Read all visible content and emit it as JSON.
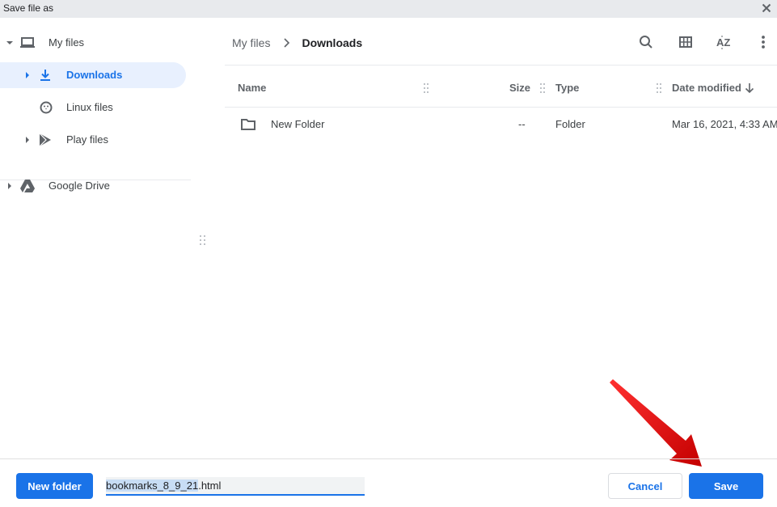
{
  "window": {
    "title": "Save file as",
    "close_icon": "close-icon"
  },
  "sidebar": {
    "items": [
      {
        "label": "My files",
        "icon": "laptop-icon",
        "expanded": true
      },
      {
        "label": "Downloads",
        "icon": "download-icon",
        "active": true
      },
      {
        "label": "Linux files",
        "icon": "linux-penguin-icon"
      },
      {
        "label": "Play files",
        "icon": "play-store-icon"
      },
      {
        "label": "Google Drive",
        "icon": "google-drive-icon"
      }
    ]
  },
  "breadcrumb": {
    "items": [
      "My files",
      "Downloads"
    ]
  },
  "toolbar": {
    "search": "search-icon",
    "grid_view": "grid-view-icon",
    "sort": "sort-az-icon",
    "more": "more-vert-icon"
  },
  "table": {
    "columns": [
      "Name",
      "Size",
      "Type",
      "Date modified"
    ],
    "sort_column": "Date modified",
    "sort_direction": "descending",
    "rows": [
      {
        "name": "New Folder",
        "size": "--",
        "type": "Folder",
        "date_modified": "Mar 16, 2021, 4:33 AM",
        "icon": "folder-icon"
      }
    ]
  },
  "footer": {
    "new_folder_label": "New folder",
    "filename_selected": "bookmarks_8_9_21",
    "filename_extension": ".html",
    "cancel_label": "Cancel",
    "save_label": "Save"
  },
  "colors": {
    "accent": "#1a73e8",
    "active_bg": "#e8f0fe",
    "titlebar_bg": "#e8eaed",
    "annotation_arrow": "#e00000"
  }
}
